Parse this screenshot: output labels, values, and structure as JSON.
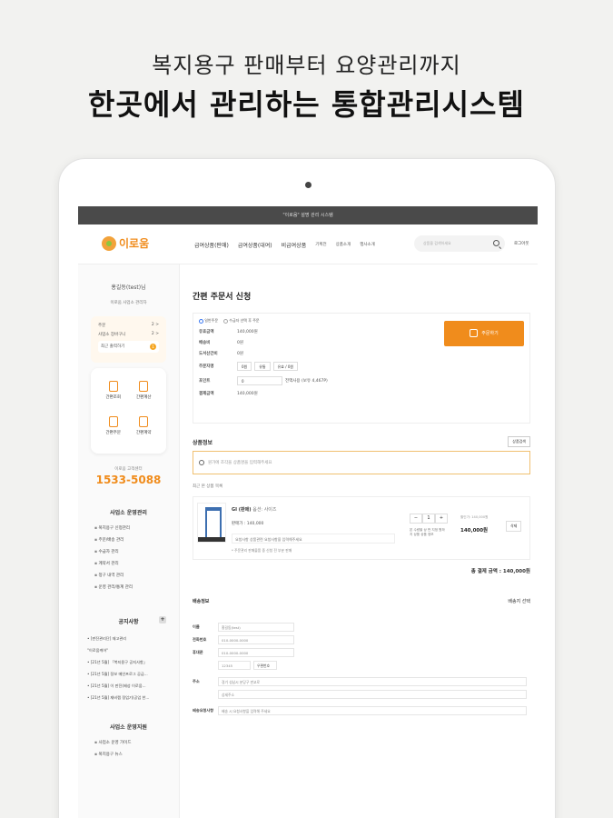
{
  "hero": {
    "line1": "복지용구 판매부터 요양관리까지",
    "line2": "한곳에서 관리하는 통합관리시스템"
  },
  "app": {
    "topbar": "\"이로움\" 설명 관리 시스템",
    "logo": "이로움",
    "nav": [
      "급여상품(판매)",
      "급여상품(대여)",
      "비급여상품"
    ],
    "nav_small": [
      "기획전",
      "상품소개",
      "행사소개"
    ],
    "search_placeholder": "상품을 검색하세요",
    "logout": "로그아웃"
  },
  "sidebar": {
    "user_name": "홍길동(test)님",
    "user_sub": "이로움 사업소 관리자",
    "cart_rows": [
      {
        "label": "주문",
        "value": "2 >"
      },
      {
        "label": "사업소 장바구니",
        "value": "2 >"
      }
    ],
    "cart_highlight": "최근 출력하기",
    "cart_badge": "1",
    "quick": [
      "간편조회",
      "간편계산",
      "간편주문",
      "간편계약"
    ],
    "cs_label": "이로움 고객센터",
    "cs_phone": "1533-5088",
    "sec1_title": "사업소 운영관리",
    "sec1_items": [
      "복지용구 신청관리",
      "주문/배송 관리",
      "수급자 관리",
      "계약서 관리",
      "청구 내역 관리",
      "운영 관리/통계 관리"
    ],
    "notice_title": "공지사항",
    "notice_plus": "+",
    "notices": [
      "• [판진관리단] 재고관리",
      "  \"이로움케어\"",
      "• [21년 5월] 「복지용구 공지사항」",
      "• [21년 5월] 정보 메인프로그 공급...",
      "• [21년 5월] 이 판진(배성 이로움...",
      "• [21년 5월] 재비캡 정업기(공업 한..."
    ],
    "sec2_title": "사업소 운영지원",
    "sec2_items": [
      "사업소 운영 가이드",
      "복지용구 뉴스"
    ]
  },
  "main": {
    "title": "간편 주문서 신청",
    "options": [
      "일반주문",
      "수급자 선택 후 주문"
    ],
    "rows": [
      {
        "k": "유효금액",
        "v": "140,000원"
      },
      {
        "k": "배송비",
        "v": "0원"
      },
      {
        "k": "도서산간비",
        "v": "0원"
      },
      {
        "k": "주문자명",
        "v": ""
      },
      {
        "k": "포인트",
        "v": ""
      },
      {
        "k": "결제금액",
        "v": "140,000원"
      }
    ],
    "orderer_boxes": [
      "0원",
      "유통",
      "유효 / 0원"
    ],
    "point_box": "0",
    "point_note": "전액사용 (보유 4,467P)",
    "order_button": "주문하기",
    "product_section": "상품정보",
    "product_btn": "상품검색",
    "product_search_placeholder": "원가에 조각을 상품명을 입력해주세요",
    "selected_label": "최근 본 상품 목록",
    "product": {
      "name": "GI (판매)",
      "option": "옵션: 사이즈",
      "price": "판매가 : 140,000",
      "memo": "요청사항 상품관련 요청사항을 입력해주세요",
      "note": "* 주문관리 판매물품 중 신청 전 부분 판매",
      "qty": "1",
      "qty_note": "본 수량을 상 판 지정 원하지 \n 상품 상품 정보",
      "amount_label": "할인가: 140,000원",
      "amount": "140,000원",
      "delete": "삭제"
    },
    "total": "총 결제 금액 : 140,000원",
    "ship_title": "배송정보",
    "ship_option": "배송지 선택",
    "ship_rows": [
      {
        "k": "이름",
        "v": "홍길동(test)"
      },
      {
        "k": "전화번호",
        "v": "010-0000-0000"
      },
      {
        "k": "휴대폰",
        "v": "010-0000-0000"
      },
      {
        "k": "",
        "v": "12345"
      },
      {
        "k": "주소",
        "v": "경기 성남시 분당구 판교로"
      },
      {
        "k": "",
        "v": "상세주소"
      },
      {
        "k": "배송요청사항",
        "v": "배송 시 요청사항을 입력해 주세요"
      }
    ],
    "zip_button": "우편번호"
  }
}
